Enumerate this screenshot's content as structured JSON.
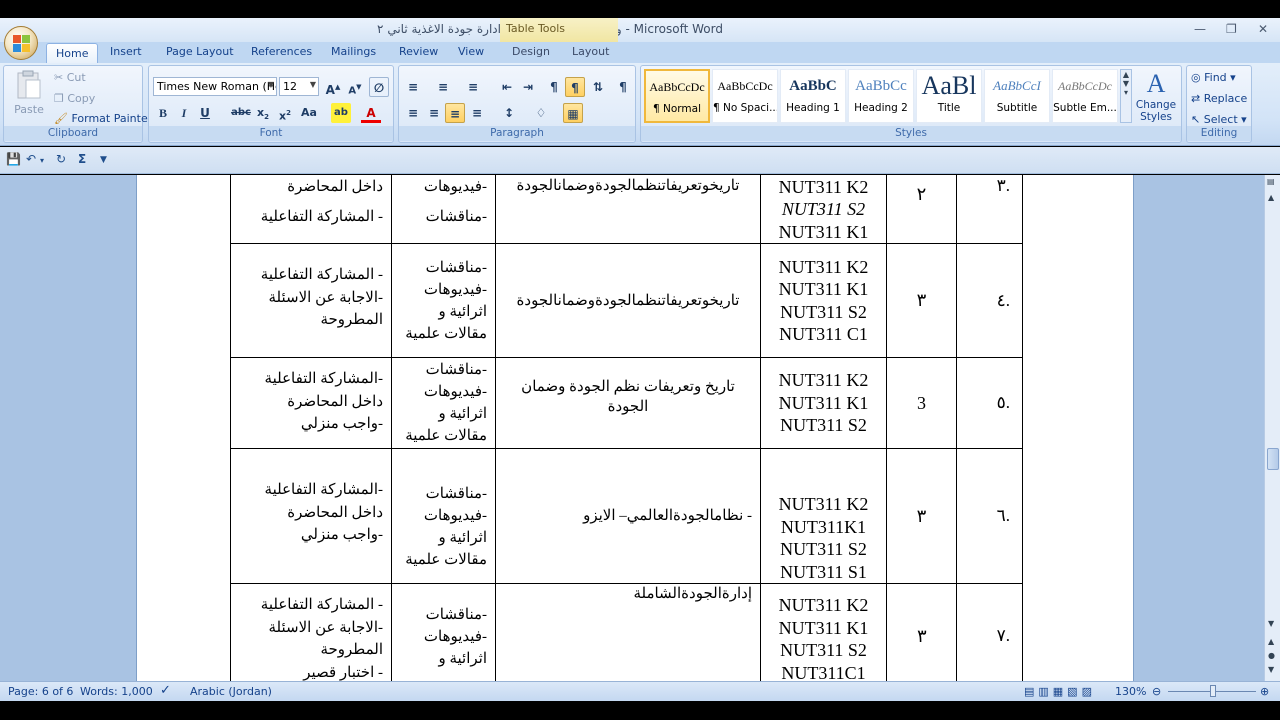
{
  "window": {
    "title": "وصف مقرر ضبط ونظم ادارة جودة الاغذية ثاني ٢ - Microsoft Word",
    "context_tab": "Table Tools"
  },
  "tabs": [
    "Home",
    "Insert",
    "Page Layout",
    "References",
    "Mailings",
    "Review",
    "View",
    "Design",
    "Layout"
  ],
  "clipboard": {
    "paste": "Paste",
    "cut": "Cut",
    "copy": "Copy",
    "format_painter": "Format Painter",
    "label": "Clipboard"
  },
  "font": {
    "name": "Times New Roman (Hea",
    "size": "12",
    "label": "Font"
  },
  "paragraph": {
    "label": "Paragraph"
  },
  "styles": {
    "label": "Styles",
    "items": [
      {
        "sample": "AaBbCcDc",
        "name": "¶ Normal"
      },
      {
        "sample": "AaBbCcDc",
        "name": "¶ No Spaci..."
      },
      {
        "sample": "AaBbC",
        "name": "Heading 1"
      },
      {
        "sample": "AaBbCc",
        "name": "Heading 2"
      },
      {
        "sample": "AaBl",
        "name": "Title"
      },
      {
        "sample": "AaBbCcI",
        "name": "Subtitle"
      },
      {
        "sample": "AaBbCcDc",
        "name": "Subtle Em..."
      }
    ],
    "change_styles": "Change Styles"
  },
  "editing": {
    "label": "Editing",
    "find": "Find",
    "replace": "Replace",
    "select": "Select"
  },
  "table": {
    "rows": [
      {
        "num": ".٣",
        "week": "٢",
        "codes": [
          "NUT311 K2",
          "NUT311 S2",
          "NUT311 K1"
        ],
        "topic": "تاريخوتعريفاتنظمالجودةوضمانالجودة",
        "methods": [
          "-فيديوهات",
          "-مناقشات"
        ],
        "assess": [
          "داخل المحاضرة",
          "- المشاركة التفاعلية"
        ]
      },
      {
        "num": ".٤",
        "week": "٣",
        "codes": [
          "NUT311 K2",
          "NUT311 K1",
          "NUT311 S2",
          "NUT311 C1"
        ],
        "topic": "تاريخوتعريفاتنظمالجودةوضمانالجودة",
        "methods": [
          "-مناقشات",
          "-فيديوهات",
          "اثرائية و",
          "مقالات علمية"
        ],
        "assess": [
          "- المشاركة التفاعلية",
          "-الاجابة عن الاسئلة",
          "المطروحة"
        ]
      },
      {
        "num": ".٥",
        "week": "3",
        "codes": [
          "NUT311 K2",
          "NUT311 K1",
          "NUT311 S2"
        ],
        "topic": "تاريخ وتعريفات نظم الجودة وضمان الجودة",
        "methods": [
          "-مناقشات",
          "-فيديوهات",
          "اثرائية و",
          "مقالات علمية"
        ],
        "assess": [
          "-المشاركة التفاعلية",
          "داخل المحاضرة",
          "-واجب منزلي"
        ]
      },
      {
        "num": ".٦",
        "week": "٣",
        "codes": [
          "NUT311 K2",
          "NUT311K1",
          "NUT311 S2",
          "NUT311 S1"
        ],
        "topic": "- نظامالجودةالعالمي– الايزو",
        "methods": [
          "-مناقشات",
          "-فيديوهات",
          "اثرائية و",
          "مقالات علمية"
        ],
        "assess": [
          "-المشاركة التفاعلية",
          "داخل المحاضرة",
          "-واجب منزلي"
        ]
      },
      {
        "num": ".٧",
        "week": "٣",
        "codes": [
          "NUT311 K2",
          "NUT311 K1",
          "NUT311 S2",
          "NUT311C1"
        ],
        "topic": "إدارةالجودةالشاملة",
        "methods": [
          "-مناقشات",
          "-فيديوهات",
          "اثرائية و"
        ],
        "assess": [
          "- المشاركة التفاعلية",
          "-الاجابة عن الاسئلة",
          "المطروحة",
          "- اختبار قصير"
        ]
      }
    ]
  },
  "status": {
    "page": "Page: 6 of 6",
    "words": "Words: 1,000",
    "language": "Arabic (Jordan)",
    "zoom": "130%"
  }
}
